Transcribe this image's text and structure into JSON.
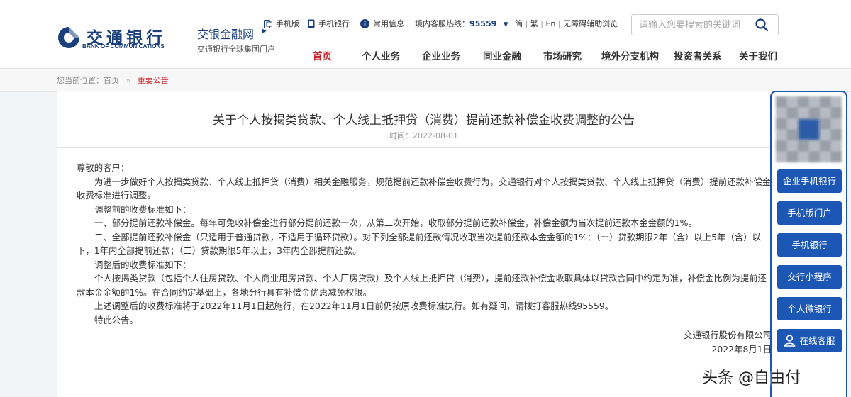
{
  "brand": {
    "cn": "交通银行",
    "en": "BANK OF COMMUNICATIONS",
    "portal_name": "交银金融网",
    "portal_sub": "交通银行全球集团门户"
  },
  "utility": {
    "mobile_version": "手机版",
    "mobile_bank": "手机银行",
    "common_info": "常用信息",
    "hotline_label": "境内客服热线：",
    "hotline": "95559",
    "lang_simplified": "简",
    "lang_traditional": "繁",
    "lang_en": "En",
    "accessibility": "无障碍辅助浏览"
  },
  "search": {
    "placeholder": "请输入您要搜索的关键词"
  },
  "nav": [
    "首页",
    "个人业务",
    "企业业务",
    "同业金融",
    "市场研究",
    "境外分支机构",
    "投资者关系",
    "关于我们"
  ],
  "breadcrumb": {
    "prefix": "您当前位置：",
    "home": "首页",
    "separator": "»",
    "current": "重要公告"
  },
  "article": {
    "title": "关于个人按揭类贷款、个人线上抵押贷（消费）提前还款补偿金收费调整的公告",
    "date": "时间：2022-08-01",
    "paragraphs": [
      "尊敬的客户：",
      "为进一步做好个人按揭类贷款、个人线上抵押贷（消费）相关金融服务，规范提前还款补偿金收费行为，交通银行对个人按揭类贷款、个人线上抵押贷（消费）提前还款补偿金收费标准进行调整。",
      "调整前的收费标准如下：",
      "一、部分提前还款补偿金。每年可免收补偿金进行部分提前还款一次，从第二次开始，收取部分提前还款补偿金，补偿金额为当次提前还款本金金额的1%。",
      "二、全部提前还款补偿金（只适用于普通贷款，不适用于循环贷款）。对下列全部提前还款情况收取当次提前还款本金金额的1%：（一）贷款期限2年（含）以上5年（含）以下，1年内全部提前还款；（二）贷款期限5年以上，3年内全部提前还款。",
      "调整后的收费标准如下：",
      "个人按揭类贷款（包括个人住房贷款、个人商业用房贷款、个人厂房贷款）及个人线上抵押贷（消费），提前还款补偿金收取具体以贷款合同中约定为准，补偿金比例为提前还款本金金额的1%。在合同约定基础上，各地分行具有补偿金优惠减免权限。",
      "上述调整后的收费标准将于2022年11月1日起施行，在2022年11月1日前仍按原收费标准执行。如有疑问，请拨打客服热线95559。",
      "特此公告。"
    ],
    "signature": "交通银行股份有限公司",
    "sign_date": "2022年8月1日"
  },
  "sidebar": [
    "企业手机银行",
    "手机版门户",
    "手机银行",
    "交行小程序",
    "个人微银行",
    "在线客服"
  ],
  "watermark": "头条 @自由付",
  "colors": {
    "brand_blue": "#1b3f7a",
    "side_blue": "#1c57b5",
    "accent_red": "#c4282f"
  }
}
